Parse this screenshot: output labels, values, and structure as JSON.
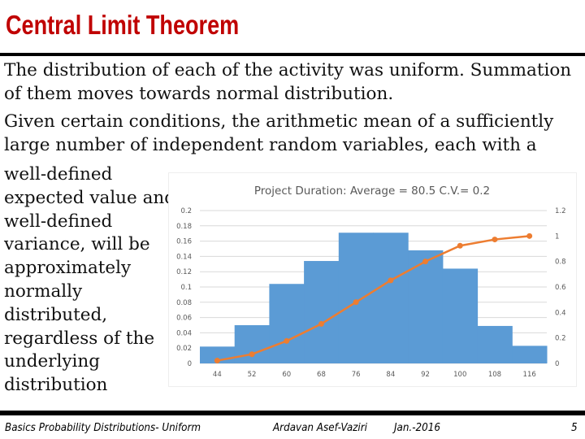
{
  "slide": {
    "title": "Central Limit Theorem",
    "paragraph1": [
      "The distribution of each of the activity was uniform. Summation",
      "of them moves towards normal distribution."
    ],
    "paragraph2": [
      "Given certain conditions, the arithmetic mean of a sufficiently",
      "large number of independent random variables, each with a"
    ],
    "paragraph3": [
      "well-defined",
      "expected value and",
      "well-defined",
      "variance, will be",
      "approximately",
      "normally",
      "distributed,",
      "regardless of the",
      "underlying",
      "distribution"
    ]
  },
  "footer": {
    "left": "Basics Probability Distributions- Uniform",
    "author": "Ardavan Asef-Vaziri",
    "date": "Jan.-2016",
    "page": "5"
  },
  "chart_data": {
    "type": "bar",
    "title": "Project Duration: Average = 80.5 C.V.= 0.2",
    "categories": [
      "44",
      "52",
      "60",
      "68",
      "76",
      "84",
      "92",
      "100",
      "108",
      "116"
    ],
    "series": [
      {
        "type": "bar",
        "axis": "left",
        "color": "#5b9bd5",
        "values": [
          0.022,
          0.05,
          0.104,
          0.134,
          0.171,
          0.171,
          0.148,
          0.124,
          0.049,
          0.023
        ]
      },
      {
        "type": "line",
        "axis": "right",
        "color": "#ed7d31",
        "values": [
          0.022,
          0.072,
          0.176,
          0.31,
          0.481,
          0.652,
          0.8,
          0.924,
          0.973,
          1.0
        ]
      }
    ],
    "left_ticks": [
      "0",
      "0.02",
      "0.04",
      "0.06",
      "0.08",
      "0.1",
      "0.12",
      "0.14",
      "0.16",
      "0.18",
      "0.2"
    ],
    "right_ticks": [
      "0",
      "0.2",
      "0.4",
      "0.6",
      "0.8",
      "1",
      "1.2"
    ],
    "ylim_left": [
      0,
      0.2
    ],
    "ylim_right": [
      0,
      1.2
    ],
    "grid": true,
    "legend": "none"
  }
}
